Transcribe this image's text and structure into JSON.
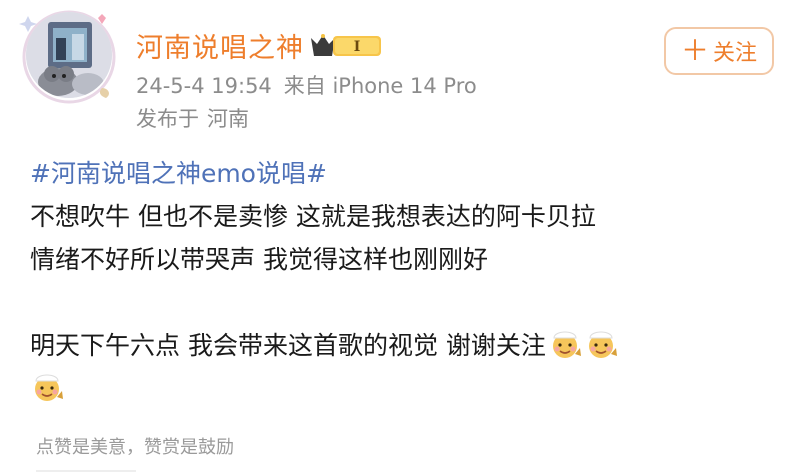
{
  "post": {
    "author": "河南说唱之神",
    "vip_level": "I",
    "timestamp": "24-5-4 19:54",
    "source": "来自 iPhone 14 Pro",
    "location_label": "发布于",
    "location": "河南",
    "follow_label": "关注",
    "hashtag": "#河南说唱之神emo说唱#",
    "lines": [
      "不想吹牛 但也不是卖惨 这就是我想表达的阿卡贝拉",
      "情绪不好所以带哭声 我觉得这样也刚刚好",
      "明天下午六点 我会带来这首歌的视觉  谢谢关注"
    ],
    "emojis": [
      "chef-baby-emoji",
      "chef-baby-emoji",
      "chef-baby-emoji"
    ],
    "footer": "点赞是美意，赞赏是鼓励"
  },
  "colors": {
    "username": "#ee7e2c",
    "hashtag": "#4f72b8",
    "meta": "#8c8c8c",
    "follow_border": "#f2c8a6"
  }
}
